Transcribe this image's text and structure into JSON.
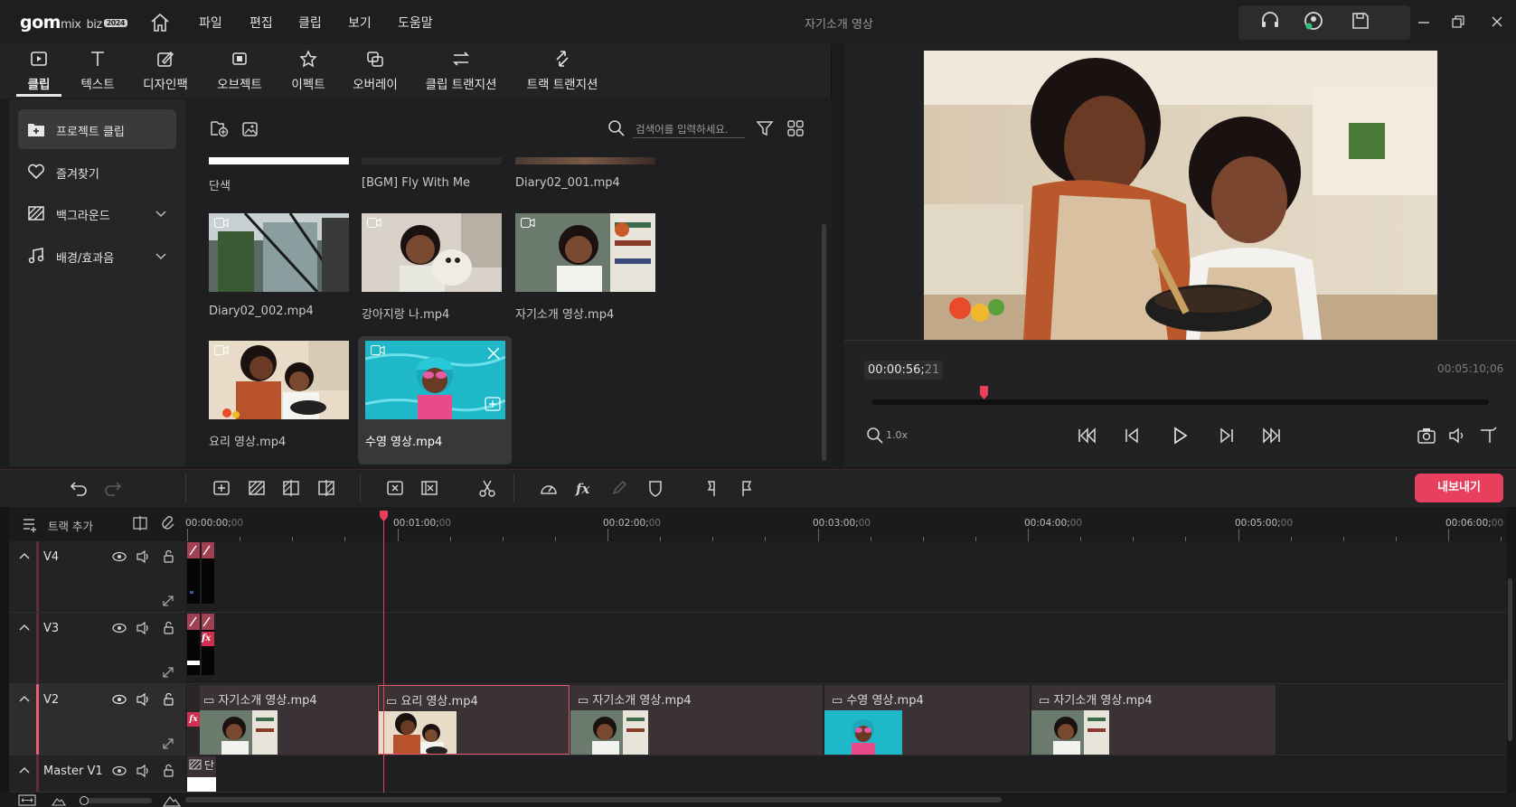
{
  "app": {
    "logo_main": "gom",
    "logo_mix": "mix",
    "logo_biz": "biz",
    "logo_badge": "2024",
    "document_title": "자기소개 영상"
  },
  "menu": [
    "파일",
    "편집",
    "클립",
    "보기",
    "도움말"
  ],
  "tabs": [
    "클립",
    "텍스트",
    "디자인팩",
    "오브젝트",
    "이펙트",
    "오버레이",
    "클립 트랜지션",
    "트랙 트랜지션"
  ],
  "sidebar": {
    "items": [
      {
        "label": "프로젝트 클립",
        "icon": "add-folder-icon"
      },
      {
        "label": "즐겨찾기",
        "icon": "heart-icon"
      },
      {
        "label": "백그라운드",
        "icon": "pattern-icon"
      },
      {
        "label": "배경/효과음",
        "icon": "music-note-icon"
      }
    ]
  },
  "media": {
    "search_placeholder": "검색어를 입력하세요.",
    "clips": [
      {
        "label": "단색"
      },
      {
        "label": "[BGM] Fly With Me"
      },
      {
        "label": "Diary02_001.mp4"
      },
      {
        "label": "Diary02_002.mp4"
      },
      {
        "label": "강아지랑 나.mp4"
      },
      {
        "label": "자기소개 영상.mp4"
      },
      {
        "label": "요리 영상.mp4"
      },
      {
        "label": "수영 영상.mp4"
      }
    ]
  },
  "preview": {
    "current_time_main": "00:00:56;",
    "current_time_frames": "21",
    "total_time": "00:05:10;06",
    "zoom": "1.0x",
    "playhead_fraction": 0.182
  },
  "toolbar": {
    "export_label": "내보내기"
  },
  "timeline": {
    "add_track_label": "트랙 추가",
    "ruler": [
      {
        "main": "00:00:00;",
        "dim": "00"
      },
      {
        "main": "00:01:00;",
        "dim": "00"
      },
      {
        "main": "00:02:00;",
        "dim": "00"
      },
      {
        "main": "00:03:00;",
        "dim": "00"
      },
      {
        "main": "00:04:00;",
        "dim": "00"
      },
      {
        "main": "00:05:00;",
        "dim": "00"
      },
      {
        "main": "00:06:00;",
        "dim": "00"
      }
    ],
    "tracks": [
      {
        "name": "V4"
      },
      {
        "name": "V3"
      },
      {
        "name": "V2"
      },
      {
        "name": "Master V1"
      }
    ],
    "v2_clips": [
      "자기소개 영상.mp4",
      "요리 영상.mp4",
      "자기소개 영상.mp4",
      "수영 영상.mp4",
      "자기소개 영상.mp4"
    ],
    "master_clip_label": "단",
    "fx_label": "fx"
  },
  "colors": {
    "accent": "#e8405c",
    "panel": "#232325",
    "background": "#1c1c1e"
  }
}
